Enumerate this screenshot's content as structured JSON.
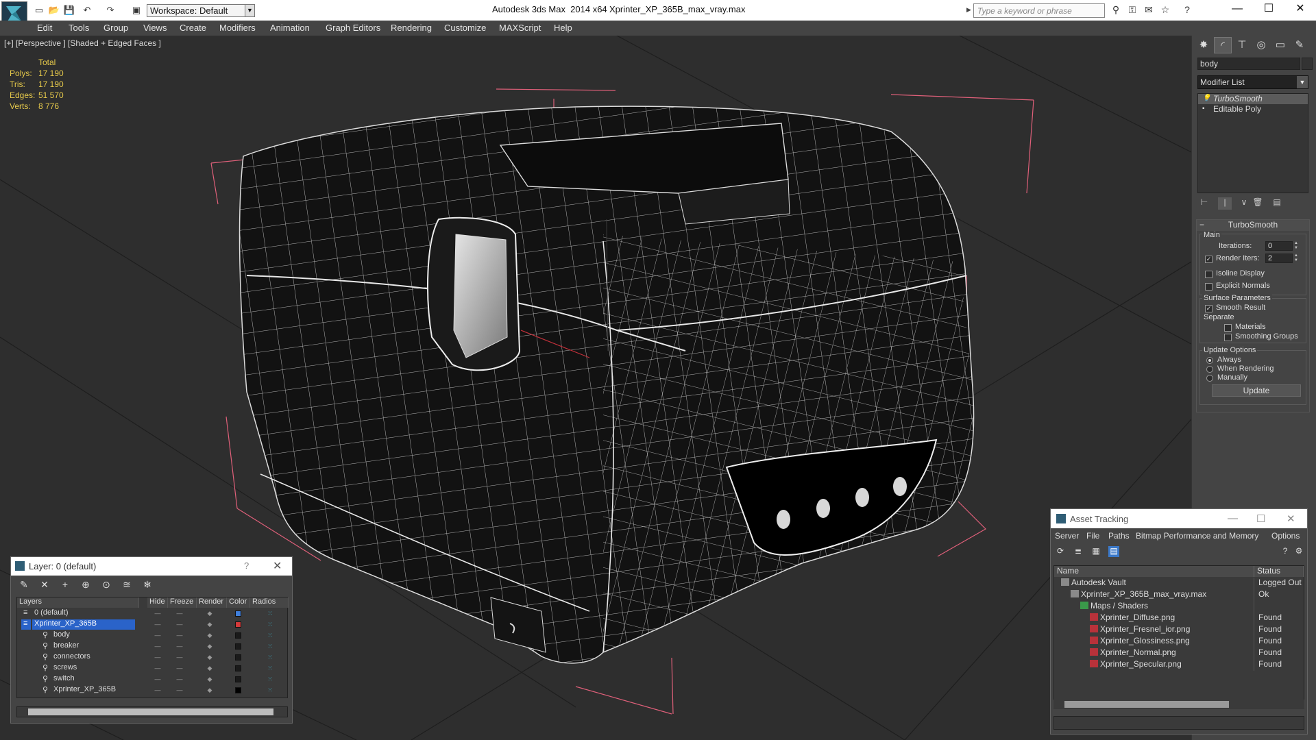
{
  "titlebar": {
    "app_title": "Autodesk 3ds Max  2014 x64",
    "file_title": "Xprinter_XP_365B_max_vray.max",
    "workspace": "Workspace: Default",
    "search_placeholder": "Type a keyword or phrase",
    "window_controls": [
      "minimize",
      "maximize",
      "close"
    ]
  },
  "menu": {
    "items": [
      "Edit",
      "Tools",
      "Group",
      "Views",
      "Create",
      "Modifiers",
      "Animation",
      "Graph Editors",
      "Rendering",
      "Customize",
      "MAXScript",
      "Help"
    ]
  },
  "viewport": {
    "label": "[+] [Perspective ] [Shaded + Edged Faces ]",
    "stats": {
      "header": "Total",
      "rows": [
        {
          "key": "Polys:",
          "value": "17 190"
        },
        {
          "key": "Tris:",
          "value": "17 190"
        },
        {
          "key": "Edges:",
          "value": "51 570"
        },
        {
          "key": "Verts:",
          "value": "8 776"
        }
      ]
    }
  },
  "command_panel": {
    "object_name": "body",
    "modifier_list": "Modifier List",
    "stack": [
      "TurboSmooth",
      "Editable Poly"
    ],
    "rollout_title": "TurboSmooth",
    "main_label": "Main",
    "iterations_label": "Iterations:",
    "iterations_value": "0",
    "render_iters_label": "Render Iters:",
    "render_iters_value": "2",
    "isoline_label": "Isoline Display",
    "explicit_normals_label": "Explicit Normals",
    "surface_params_label": "Surface Parameters",
    "smooth_result_label": "Smooth Result",
    "separate_label": "Separate",
    "materials_label": "Materials",
    "smoothing_groups_label": "Smoothing Groups",
    "update_options_label": "Update Options",
    "always_label": "Always",
    "when_rendering_label": "When Rendering",
    "manually_label": "Manually",
    "update_button": "Update"
  },
  "layers": {
    "title": "Layer: 0 (default)",
    "help": "?",
    "columns": [
      "Layers",
      "Hide",
      "Freeze",
      "Render",
      "Color",
      "Radios"
    ],
    "rows": [
      {
        "name": "0 (default)",
        "color": "#3f7fdc",
        "selected": false
      },
      {
        "name": "Xprinter_XP_365B",
        "color": "#d43a3a",
        "selected": true
      },
      {
        "name": "body",
        "color": "#1a1a1a",
        "selected": false
      },
      {
        "name": "breaker",
        "color": "#1a1a1a",
        "selected": false
      },
      {
        "name": "connectors",
        "color": "#1a1a1a",
        "selected": false
      },
      {
        "name": "screws",
        "color": "#1a1a1a",
        "selected": false
      },
      {
        "name": "switch",
        "color": "#1a1a1a",
        "selected": false
      },
      {
        "name": "Xprinter_XP_365B",
        "color": "#000000",
        "selected": false
      }
    ]
  },
  "asset_tracking": {
    "title": "Asset Tracking",
    "menu": [
      "Server",
      "File",
      "Paths",
      "Bitmap Performance and Memory",
      "Options"
    ],
    "columns": [
      "Name",
      "Status"
    ],
    "rows": [
      {
        "name": "Autodesk Vault",
        "status": "Logged Out",
        "indent": 0
      },
      {
        "name": "Xprinter_XP_365B_max_vray.max",
        "status": "Ok",
        "indent": 1
      },
      {
        "name": "Maps / Shaders",
        "status": "",
        "indent": 2
      },
      {
        "name": "Xprinter_Diffuse.png",
        "status": "Found",
        "indent": 3
      },
      {
        "name": "Xprinter_Fresnel_ior.png",
        "status": "Found",
        "indent": 3
      },
      {
        "name": "Xprinter_Glossiness.png",
        "status": "Found",
        "indent": 3
      },
      {
        "name": "Xprinter_Normal.png",
        "status": "Found",
        "indent": 3
      },
      {
        "name": "Xprinter_Specular.png",
        "status": "Found",
        "indent": 3
      }
    ]
  }
}
